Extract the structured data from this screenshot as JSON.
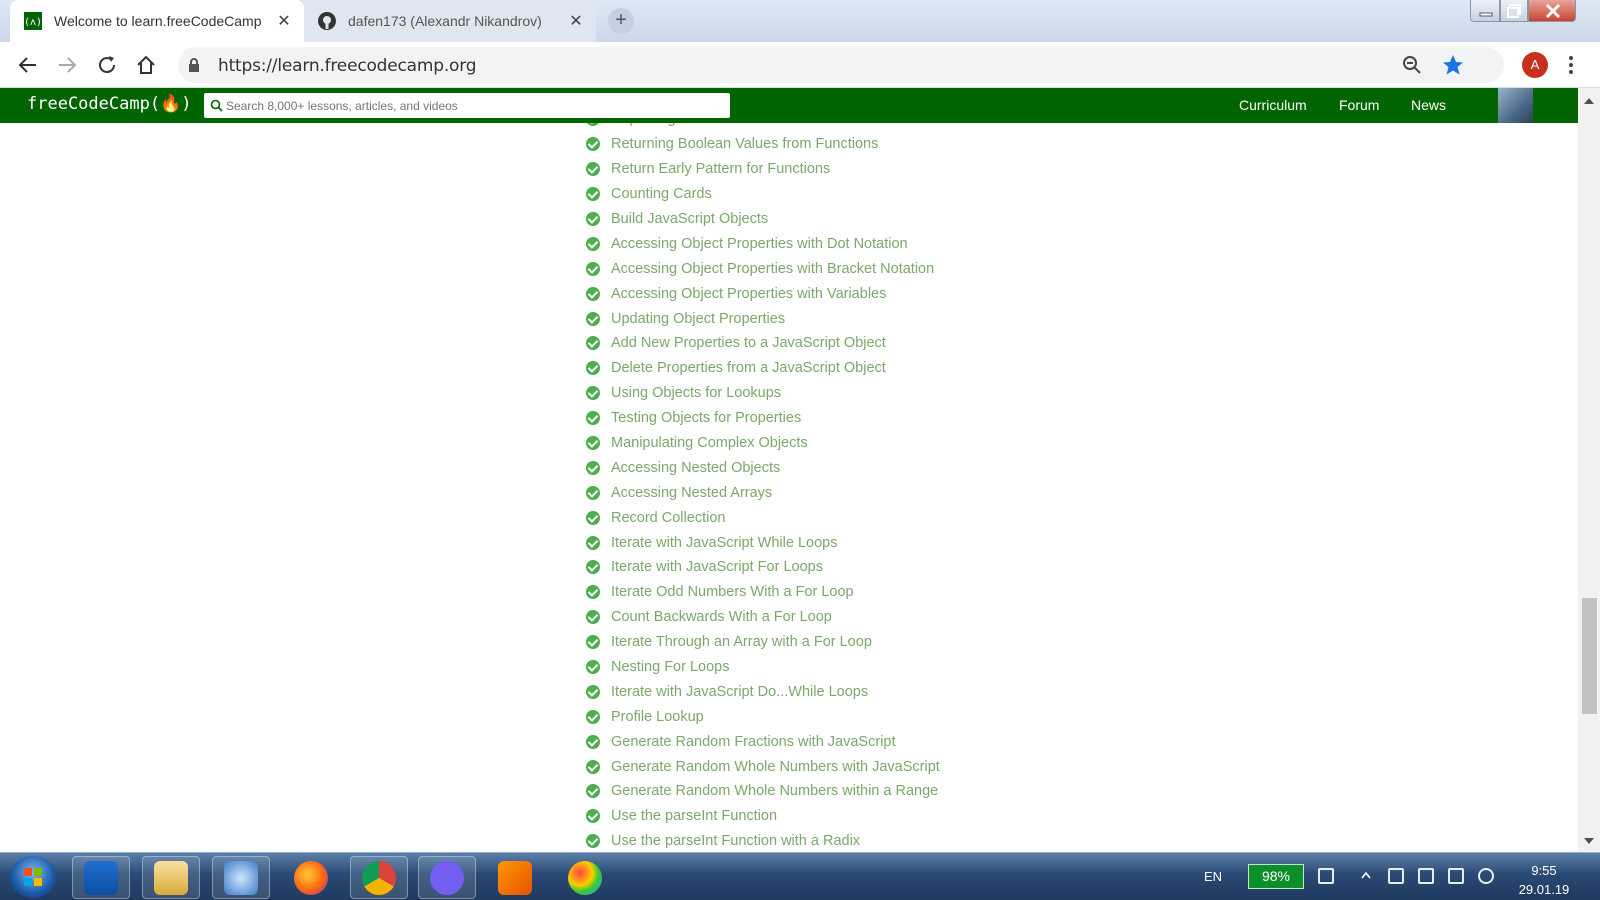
{
  "browser": {
    "tabs": [
      {
        "title": "Welcome to learn.freeCodeCamp",
        "active": true
      },
      {
        "title": "dafen173 (Alexandr Nikandrov)",
        "active": false
      }
    ],
    "new_tab": "+",
    "url": "https://learn.freecodecamp.org",
    "profile_initial": "A"
  },
  "nav": {
    "logo": "freeCodeCamp(🔥)",
    "search_placeholder": "Search 8,000+ lessons, articles, and videos",
    "links": [
      "Curriculum",
      "Forum",
      "News"
    ]
  },
  "lessons": [
    "Replacing If Else Chains with Switch",
    "Returning Boolean Values from Functions",
    "Return Early Pattern for Functions",
    "Counting Cards",
    "Build JavaScript Objects",
    "Accessing Object Properties with Dot Notation",
    "Accessing Object Properties with Bracket Notation",
    "Accessing Object Properties with Variables",
    "Updating Object Properties",
    "Add New Properties to a JavaScript Object",
    "Delete Properties from a JavaScript Object",
    "Using Objects for Lookups",
    "Testing Objects for Properties",
    "Manipulating Complex Objects",
    "Accessing Nested Objects",
    "Accessing Nested Arrays",
    "Record Collection",
    "Iterate with JavaScript While Loops",
    "Iterate with JavaScript For Loops",
    "Iterate Odd Numbers With a For Loop",
    "Count Backwards With a For Loop",
    "Iterate Through an Array with a For Loop",
    "Nesting For Loops",
    "Iterate with JavaScript Do...While Loops",
    "Profile Lookup",
    "Generate Random Fractions with JavaScript",
    "Generate Random Whole Numbers with JavaScript",
    "Generate Random Whole Numbers within a Range",
    "Use the parseInt Function",
    "Use the parseInt Function with a Radix"
  ],
  "taskbar": {
    "apps": [
      "outlook-icon",
      "explorer-icon",
      "search-tool-icon",
      "firefox-icon",
      "chrome-icon",
      "viber-icon",
      "sublime-icon",
      "paint-icon"
    ],
    "language": "EN",
    "battery": "98%",
    "time": "9:55",
    "date": "29.01.19"
  },
  "colors": {
    "fcc_green": "#006400",
    "lesson_text": "#7aa96b",
    "check_green": "#4cae4c",
    "profile_red": "#c5311c"
  }
}
